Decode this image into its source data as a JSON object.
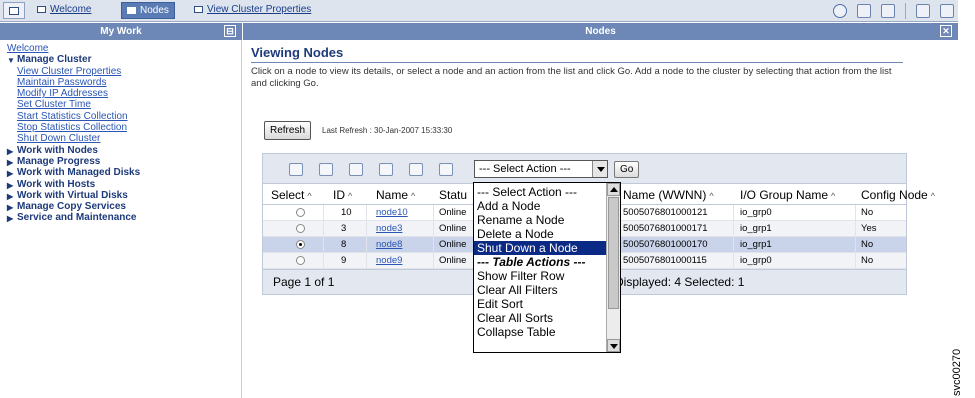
{
  "tabs": [
    {
      "label": "Welcome",
      "active": false
    },
    {
      "label": "Nodes",
      "active": true
    },
    {
      "label": "View Cluster Properties",
      "active": false
    }
  ],
  "left": {
    "header": "My Work",
    "welcome": "Welcome",
    "manage_cluster": "Manage Cluster",
    "sub_items": [
      "View Cluster Properties",
      "Maintain Passwords",
      "Modify IP Addresses",
      "Set Cluster Time",
      "Start Statistics Collection",
      "Stop Statistics Collection",
      "Shut Down Cluster"
    ],
    "groups": [
      "Work with Nodes",
      "Manage Progress",
      "Work with Managed Disks",
      "Work with Hosts",
      "Work with Virtual Disks",
      "Manage Copy Services",
      "Service and Maintenance"
    ]
  },
  "main": {
    "header": "Nodes",
    "title": "Viewing Nodes",
    "instructions": "Click on a node to view its details, or select a node and an action from the list and click Go. Add a node to the cluster by selecting that action from the list and clicking Go.",
    "refresh_label": "Refresh",
    "last_refresh": "Last Refresh : 30-Jan-2007 15:33:30",
    "select_action": "--- Select Action ---",
    "go_label": "Go",
    "columns": {
      "select": "Select",
      "id": "ID",
      "name": "Name",
      "status": "Statu",
      "wwnn": "Name (WWNN)",
      "io_group": "I/O Group Name",
      "config": "Config Node"
    },
    "rows": [
      {
        "id": "10",
        "name": "node10",
        "status": "Online",
        "wwnn": "5005076801000121",
        "io_group": "io_grp0",
        "config": "No"
      },
      {
        "id": "3",
        "name": "node3",
        "status": "Online",
        "wwnn": "5005076801000171",
        "io_group": "io_grp1",
        "config": "Yes"
      },
      {
        "id": "8",
        "name": "node8",
        "status": "Online",
        "wwnn": "5005076801000170",
        "io_group": "io_grp1",
        "config": "No"
      },
      {
        "id": "9",
        "name": "node9",
        "status": "Online",
        "wwnn": "5005076801000115",
        "io_group": "io_grp0",
        "config": "No"
      }
    ],
    "page_info": "Page 1 of 1",
    "totals": "4   Displayed: 4   Selected: 1"
  },
  "dropdown": {
    "items": [
      "--- Select Action ---",
      "Add a Node",
      "Rename a Node",
      "Delete a Node",
      "Shut Down a Node",
      "--- Table Actions ---",
      "Show Filter Row",
      "Clear All Filters",
      "Edit Sort",
      "Clear All Sorts",
      "Collapse Table"
    ]
  },
  "side_label": "svc00270"
}
